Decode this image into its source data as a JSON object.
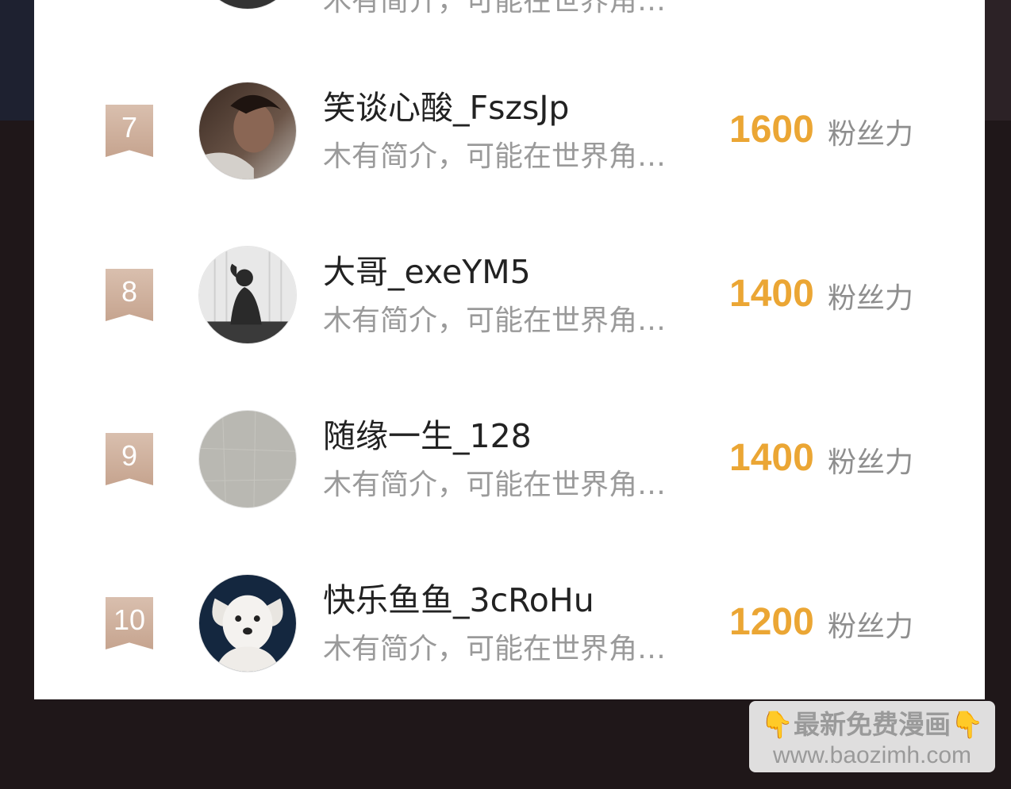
{
  "leaderboard": {
    "partial_row": {
      "bio": "木有简介，可能在世界角…"
    },
    "rows": [
      {
        "rank": "7",
        "name": "笑谈心酸_FszsJp",
        "bio": "木有简介，可能在世界角…",
        "score": "1600",
        "unit": "粉丝力",
        "avatar_icon": "man-portrait-avatar"
      },
      {
        "rank": "8",
        "name": "大哥_exeYM5",
        "bio": "木有简介，可能在世界角…",
        "score": "1400",
        "unit": "粉丝力",
        "avatar_icon": "silhouette-window-avatar"
      },
      {
        "rank": "9",
        "name": "随缘一生_128",
        "bio": "木有简介，可能在世界角…",
        "score": "1400",
        "unit": "粉丝力",
        "avatar_icon": "gray-wall-avatar"
      },
      {
        "rank": "10",
        "name": "快乐鱼鱼_3cRoHu",
        "bio": "木有简介，可能在世界角…",
        "score": "1200",
        "unit": "粉丝力",
        "avatar_icon": "white-dog-avatar"
      }
    ]
  },
  "watermark": {
    "line1": "最新免费漫画",
    "line2": "www.baozimh.com",
    "hand_icon": "👇"
  },
  "colors": {
    "score": "#eba634",
    "rank_badge": "#c6a48f",
    "background": "#1f1719"
  }
}
